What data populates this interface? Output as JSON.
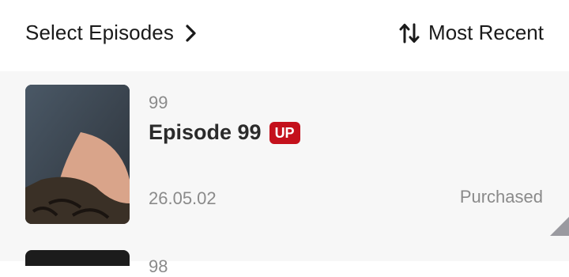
{
  "header": {
    "select_label": "Select Episodes",
    "sort_label": "Most Recent"
  },
  "episodes": [
    {
      "number": "99",
      "title": "Episode 99",
      "badge": "UP",
      "date": "26.05.02",
      "status": "Purchased"
    },
    {
      "number": "98"
    }
  ],
  "colors": {
    "badge_bg": "#c4111c",
    "list_bg": "#f7f7f7",
    "secondary_text": "#8a8a8a",
    "primary_text": "#1a1a1a"
  },
  "icons": {
    "select_chevron": "chevron-right-icon",
    "sort": "sort-arrows-icon",
    "corner": "corner-fold-icon"
  }
}
